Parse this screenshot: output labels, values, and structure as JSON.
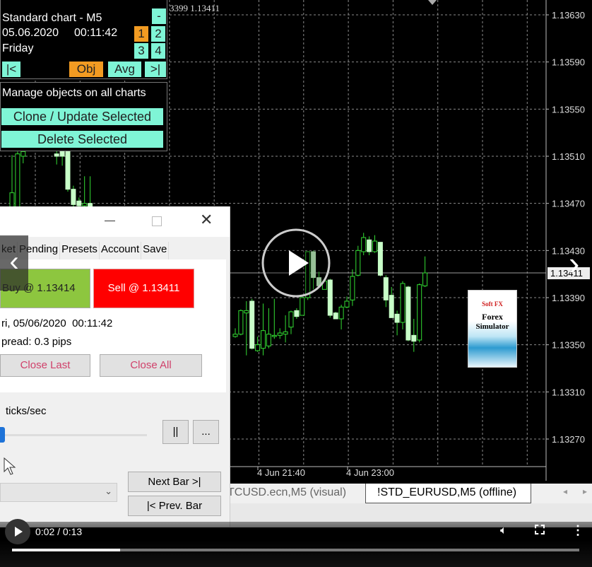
{
  "chart": {
    "top_readout": "3399 1.13411",
    "price_labels": [
      "1.13630",
      "1.13590",
      "1.13550",
      "1.13510",
      "1.13470",
      "1.13430",
      "1.13390",
      "1.13350",
      "1.13310",
      "1.13270"
    ],
    "bid_price": "1.13411",
    "time_labels": [
      "4 Jun 21:40",
      "4 Jun 23:00"
    ],
    "colors": {
      "bull": "#33dd33",
      "bear_fill": "#c8ffc8",
      "wick": "#33dd33",
      "grid": "#8a8a8a",
      "bid_line": "#9a9a9a"
    },
    "candles_ohlc": [
      [
        1.13467,
        1.13511,
        1.13467,
        1.13479
      ],
      [
        1.13467,
        1.13514,
        1.13467,
        1.13512
      ],
      [
        1.1351,
        1.13515,
        1.13504,
        1.13514
      ],
      null,
      null,
      null,
      null,
      null,
      [
        1.13512,
        1.13515,
        1.13503,
        1.1351
      ],
      [
        1.13514,
        1.13514,
        1.13502,
        1.1351
      ],
      [
        1.13515,
        1.13515,
        1.1348,
        1.13482
      ],
      [
        1.13482,
        1.13485,
        1.13467,
        1.13469
      ],
      [
        1.13472,
        1.13475,
        1.13466,
        1.13468
      ],
      [
        1.13468,
        1.13493,
        1.13467,
        1.1347
      ],
      [
        1.1347,
        1.13493,
        1.13467,
        1.13467
      ],
      null,
      null,
      null,
      null,
      null,
      null,
      null,
      null,
      null,
      null,
      null,
      null,
      null,
      null,
      null,
      null,
      null,
      null,
      null,
      null,
      null,
      null,
      null,
      null,
      null,
      [
        1.13357,
        1.13364,
        1.13356,
        1.13359
      ],
      [
        1.13359,
        1.1338,
        1.13358,
        1.13379
      ],
      [
        1.13377,
        1.13387,
        1.13341,
        1.13379
      ],
      [
        1.13387,
        1.13389,
        1.13346,
        1.13347
      ],
      [
        1.13345,
        1.13357,
        1.13344,
        1.1335
      ],
      [
        1.13347,
        1.13385,
        1.13341,
        1.13362
      ],
      [
        1.13349,
        1.13381,
        1.13347,
        1.13359
      ],
      [
        1.13357,
        1.13389,
        1.13355,
        1.13358
      ],
      [
        1.13358,
        1.13364,
        1.13355,
        1.1336
      ],
      [
        1.13359,
        1.13375,
        1.13352,
        1.13361
      ],
      [
        1.13365,
        1.13379,
        1.13359,
        1.13378
      ],
      [
        1.13379,
        1.13381,
        1.13372,
        1.13374
      ],
      [
        1.13375,
        1.13391,
        1.13375,
        1.1339
      ],
      [
        1.1339,
        1.13429,
        1.13388,
        1.13429
      ],
      [
        1.13429,
        1.1343,
        1.13397,
        1.13407
      ],
      [
        1.13407,
        1.13412,
        1.13399,
        1.134
      ],
      [
        1.13397,
        1.13406,
        1.13397,
        1.13404
      ],
      [
        1.13405,
        1.13406,
        1.13373,
        1.13375
      ],
      [
        1.13377,
        1.13378,
        1.13372,
        1.13372
      ],
      [
        1.13372,
        1.13384,
        1.13363,
        1.13382
      ],
      [
        1.13382,
        1.13391,
        1.13381,
        1.13387
      ],
      [
        1.13388,
        1.13414,
        1.13383,
        1.13408
      ],
      [
        1.13409,
        1.13434,
        1.13408,
        1.1343
      ],
      [
        1.13429,
        1.13445,
        1.13426,
        1.13441
      ],
      [
        1.13439,
        1.13442,
        1.13426,
        1.13429
      ],
      [
        1.13429,
        1.13443,
        1.13428,
        1.13438
      ],
      [
        1.13437,
        1.13437,
        1.13408,
        1.13409
      ],
      [
        1.13407,
        1.13409,
        1.13382,
        1.13388
      ],
      [
        1.13392,
        1.13399,
        1.13373,
        1.13373
      ],
      [
        1.13376,
        1.13379,
        1.13358,
        1.13369
      ],
      [
        1.13369,
        1.13404,
        1.13363,
        1.13402
      ],
      [
        1.13399,
        1.134,
        1.13353,
        1.13354
      ],
      [
        1.13358,
        1.13372,
        1.13344,
        1.13353
      ],
      [
        1.13354,
        1.13402,
        1.13352,
        1.13401
      ],
      [
        1.134,
        1.13425,
        1.13399,
        1.13411
      ]
    ]
  },
  "info_panel": {
    "title": "Standard chart - M5",
    "date": "05.06.2020",
    "time": "00:11:42",
    "day": "Friday",
    "minimize": "-",
    "n1": "1",
    "n2": "2",
    "n3": "3",
    "n4": "4",
    "first": "|<",
    "obj": "Obj",
    "avg": "Avg",
    "last": ">|"
  },
  "objects_panel": {
    "heading": "Manage objects on all charts",
    "clone": "Clone / Update Selected",
    "delete": "Delete Selected"
  },
  "logo": {
    "brand": "Soft FX",
    "line1": "Forex",
    "line2": "Simulator"
  },
  "dialog": {
    "tabs": [
      "ket",
      "Pending",
      "Presets",
      "Account",
      "Save"
    ],
    "buy": "Buy @ 1.13414",
    "sell": "Sell @ 1.13411",
    "datetime": "ri, 05/06/2020  00:11:42",
    "spread": "pread: 0.3 pips",
    "close_last": "Close Last",
    "close_all": "Close All",
    "speed_label": "ticks/sec",
    "speed_value": 0.0,
    "pause": "||",
    "more": "...",
    "next_bar": "Next Bar >|",
    "prev_bar": "|< Prev. Bar"
  },
  "tabs_bar": {
    "tabs": [
      "TCUSD.ecn,M5 (visual)",
      "!STD_EURUSD,M5 (offline)"
    ],
    "active": 1
  },
  "video": {
    "time": "0:02 / 0:13",
    "progress": 0.19
  }
}
